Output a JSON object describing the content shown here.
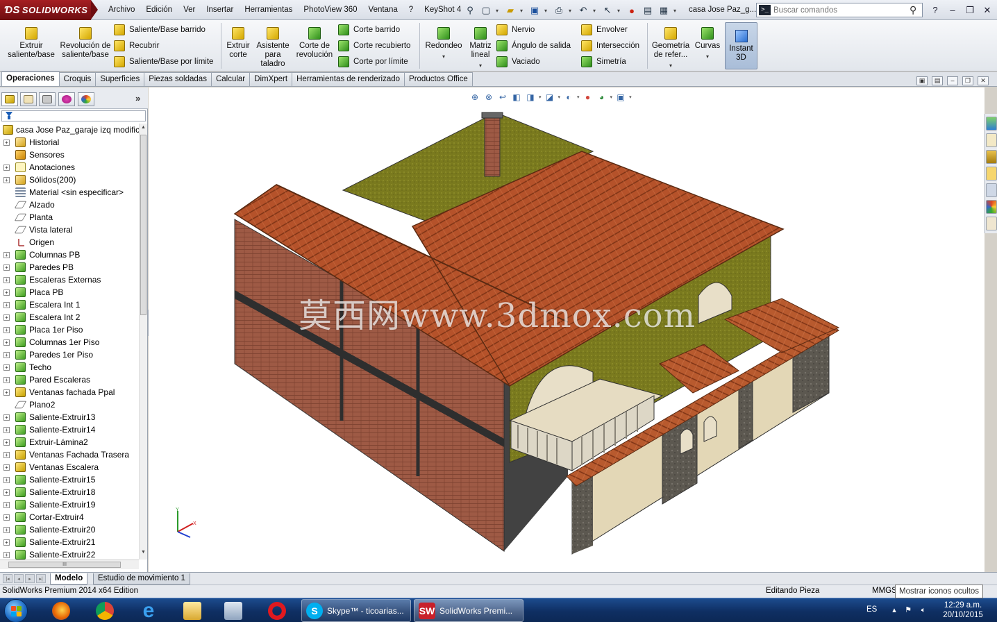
{
  "app": {
    "logo_text": "SOLIDWORKS",
    "doc_title": "casa Jose Paz_g...",
    "search_placeholder": "Buscar comandos"
  },
  "menus": [
    "Archivo",
    "Edición",
    "Ver",
    "Insertar",
    "Herramientas",
    "PhotoView 360",
    "Ventana",
    "?",
    "KeyShot 4"
  ],
  "ribbon": {
    "extruir": "Extruir saliente/base",
    "revolucion": "Revolución de saliente/base",
    "saliente_barrido": "Saliente/Base barrido",
    "recubrir": "Recubrir",
    "saliente_limite": "Saliente/Base por límite",
    "extruir_corte": "Extruir corte",
    "asistente": "Asistente para taladro",
    "corte_revolucion": "Corte de revolución",
    "corte_barrido": "Corte barrido",
    "corte_recubierto": "Corte recubierto",
    "corte_limite": "Corte por límite",
    "redondeo": "Redondeo",
    "matriz": "Matriz lineal",
    "nervio": "Nervio",
    "angulo": "Ángulo de salida",
    "vaciado": "Vaciado",
    "envolver": "Envolver",
    "interseccion": "Intersección",
    "simetria": "Simetría",
    "geometria": "Geometría de refer...",
    "curvas": "Curvas",
    "instant3d": "Instant 3D"
  },
  "tabs": [
    "Operaciones",
    "Croquis",
    "Superficies",
    "Piezas soldadas",
    "Calcular",
    "DimXpert",
    "Herramientas de renderizado",
    "Productos Office"
  ],
  "tree": {
    "root": "casa Jose Paz_garaje izq modifica",
    "items": [
      {
        "label": "Historial",
        "icon": "folder",
        "exp": true
      },
      {
        "label": "Sensores",
        "icon": "sensor",
        "exp": false
      },
      {
        "label": "Anotaciones",
        "icon": "annot",
        "exp": true
      },
      {
        "label": "Sólidos(200)",
        "icon": "folder",
        "exp": true
      },
      {
        "label": "Material <sin especificar>",
        "icon": "material",
        "exp": false
      },
      {
        "label": "Alzado",
        "icon": "plane",
        "exp": false
      },
      {
        "label": "Planta",
        "icon": "plane",
        "exp": false
      },
      {
        "label": "Vista lateral",
        "icon": "plane",
        "exp": false
      },
      {
        "label": "Origen",
        "icon": "origin",
        "exp": false
      },
      {
        "label": "Columnas PB",
        "icon": "feature",
        "exp": true
      },
      {
        "label": "Paredes PB",
        "icon": "feature",
        "exp": true
      },
      {
        "label": "Escaleras Externas",
        "icon": "feature",
        "exp": true
      },
      {
        "label": "Placa PB",
        "icon": "feature",
        "exp": true
      },
      {
        "label": "Escalera Int 1",
        "icon": "feature",
        "exp": true
      },
      {
        "label": "Escalera Int 2",
        "icon": "feature",
        "exp": true
      },
      {
        "label": "Placa 1er Piso",
        "icon": "feature",
        "exp": true
      },
      {
        "label": "Columnas 1er Piso",
        "icon": "feature",
        "exp": true
      },
      {
        "label": "Paredes 1er Piso",
        "icon": "feature",
        "exp": true
      },
      {
        "label": "Techo",
        "icon": "feature",
        "exp": true
      },
      {
        "label": "Pared Escaleras",
        "icon": "feature",
        "exp": true
      },
      {
        "label": "Ventanas fachada Ppal",
        "icon": "part",
        "exp": true
      },
      {
        "label": "Plano2",
        "icon": "plane",
        "exp": false
      },
      {
        "label": "Saliente-Extruir13",
        "icon": "feature",
        "exp": true
      },
      {
        "label": "Saliente-Extruir14",
        "icon": "feature",
        "exp": true
      },
      {
        "label": "Extruir-Lámina2",
        "icon": "feature",
        "exp": true
      },
      {
        "label": "Ventanas Fachada Trasera",
        "icon": "part",
        "exp": true
      },
      {
        "label": "Ventanas Escalera",
        "icon": "part",
        "exp": true
      },
      {
        "label": "Saliente-Extruir15",
        "icon": "feature",
        "exp": true
      },
      {
        "label": "Saliente-Extruir18",
        "icon": "feature",
        "exp": true
      },
      {
        "label": "Saliente-Extruir19",
        "icon": "feature",
        "exp": true
      },
      {
        "label": "Cortar-Extruir4",
        "icon": "feature",
        "exp": true
      },
      {
        "label": "Saliente-Extruir20",
        "icon": "feature",
        "exp": true
      },
      {
        "label": "Saliente-Extruir21",
        "icon": "feature",
        "exp": true
      },
      {
        "label": "Saliente-Extruir22",
        "icon": "feature",
        "exp": true
      }
    ]
  },
  "watermark": "莫西网www.3dmox.com",
  "model_tabs": [
    "Modelo",
    "Estudio de movimiento 1"
  ],
  "status": {
    "left": "SolidWorks Premium 2014 x64 Edition",
    "mode": "Editando Pieza",
    "units": "MMGS",
    "tooltip": "Mostrar iconos ocultos"
  },
  "taskbar": {
    "skype": "Skype™ - ticoarias...",
    "solidworks": "SolidWorks Premi...",
    "lang": "ES",
    "time": "12:29 a.m.",
    "date": "20/10/2015"
  },
  "colors": {
    "roof": "#b5522a",
    "brick": "#9e5a45",
    "stucco": "#7a7a1e",
    "accent": "#a51e22"
  }
}
